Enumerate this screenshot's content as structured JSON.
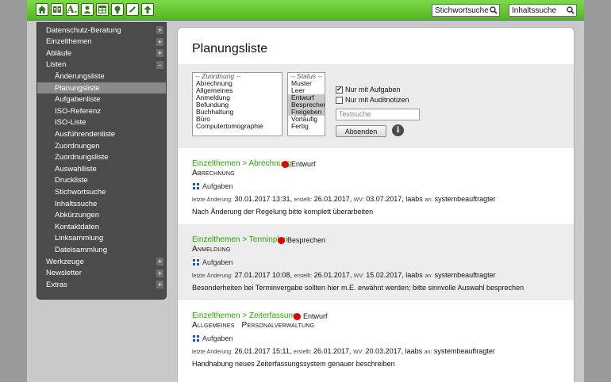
{
  "toolbar": {
    "icons": [
      "home-icon",
      "book-icon",
      "text-a-icon",
      "user-icon",
      "table-icon",
      "lightbulb-icon",
      "pencil-icon",
      "upload-icon"
    ],
    "search_keyword_value": "Stichwortsuche",
    "search_content_value": "Inhaltssuche"
  },
  "sidebar": {
    "items": [
      {
        "label": "Datenschutz-Beratung",
        "toggle": "+"
      },
      {
        "label": "Einzelthemen",
        "toggle": "+"
      },
      {
        "label": "Abläufe",
        "toggle": "+"
      },
      {
        "label": "Listen",
        "toggle": "-"
      },
      {
        "label": "Änderungsliste"
      },
      {
        "label": "Planungsliste",
        "selected": true
      },
      {
        "label": "Aufgabenliste"
      },
      {
        "label": "ISO-Referenz"
      },
      {
        "label": "ISO-Liste"
      },
      {
        "label": "Ausführendenliste"
      },
      {
        "label": "Zuordnungen"
      },
      {
        "label": "Zuordnungsliste"
      },
      {
        "label": "Auswahlliste"
      },
      {
        "label": "Druckliste"
      },
      {
        "label": "Stichwortsuche"
      },
      {
        "label": "Inhaltssuche"
      },
      {
        "label": "Abkürzungen"
      },
      {
        "label": "Kontaktdaten"
      },
      {
        "label": "Linksammlung"
      },
      {
        "label": "Dateisammlung"
      },
      {
        "label": "Werkzeuge",
        "toggle": "+"
      },
      {
        "label": "Newsletter",
        "toggle": "+"
      },
      {
        "label": "Extras",
        "toggle": "+"
      }
    ]
  },
  "main": {
    "title": "Planungsliste",
    "filter": {
      "zuordnung_header": "-- Zuordnung --",
      "zuordnung_options": [
        "Abrechnung",
        "Allgemeines",
        "Anmeldung",
        "Befundung",
        "Buchhaltung",
        "Büro",
        "Computertomographie"
      ],
      "status_header": "-- Status --",
      "status_options": [
        {
          "label": "Muster",
          "selected": false
        },
        {
          "label": "Leer",
          "selected": false
        },
        {
          "label": "Entwurf",
          "selected": true
        },
        {
          "label": "Besprechen",
          "selected": true
        },
        {
          "label": "Freigeben",
          "selected": true
        },
        {
          "label": "Vorläufig",
          "selected": false
        },
        {
          "label": "Fertig",
          "selected": false
        }
      ],
      "checkbox_tasks_label": "Nur mit Aufgaben",
      "checkbox_tasks_checked": true,
      "checkbox_audit_label": "Nur mit Auditnotizen",
      "checkbox_audit_checked": false,
      "text_search_placeholder": "Textsuche",
      "submit_label": "Absenden",
      "info_glyph": "i"
    },
    "entries": [
      {
        "path": "Einzelthemen > Abrechnung",
        "status": "Entwurf",
        "status_color": "#e00000",
        "subtitle": "Abrechnung",
        "tasks_label": "Aufgaben",
        "lbl_changed": "letzte Änderung:",
        "changed": "30.01.2017 13:31,",
        "lbl_created": "erstellt:",
        "created": "26.01.2017,",
        "lbl_wv": "WV:",
        "wv": "03.07.2017,",
        "author": "laabs",
        "lbl_an": "an:",
        "assignee": "systembeauftragter",
        "description": "Nach Änderung der Regelung bitte komplett überarbeiten"
      },
      {
        "path": "Einzelthemen > Terminplan",
        "status": "Besprechen",
        "status_color": "#e00000",
        "subtitle": "Anmeldung",
        "tasks_label": "Aufgaben",
        "lbl_changed": "letzte Änderung:",
        "changed": "27.01.2017 10:08,",
        "lbl_created": "erstellt:",
        "created": "26.01.2017,",
        "lbl_wv": "WV:",
        "wv": "15.02.2017,",
        "author": "laabs",
        "lbl_an": "an:",
        "assignee": "systembeauftragter",
        "description": "Besonderheiten bei Terminvergabe sollten hier m.E. erwähnt werden; bitte sinnvolle Auswahl besprechen"
      },
      {
        "path": "Einzelthemen > Zeiterfassung",
        "status": "Entwurf",
        "status_color": "#e00000",
        "subtitle": "Allgemeines   Personalverwaltung",
        "tasks_label": "Aufgaben",
        "lbl_changed": "letzte Änderung:",
        "changed": "26.01.2017 15:11,",
        "lbl_created": "erstellt:",
        "created": "26.01.2017,",
        "lbl_wv": "WV:",
        "wv": "20.03.2017,",
        "author": "laabs",
        "lbl_an": "an:",
        "assignee": "systembeauftragter",
        "description": "Handhabung neues Zeiterfassungssystem genauer beschreiben"
      }
    ]
  }
}
